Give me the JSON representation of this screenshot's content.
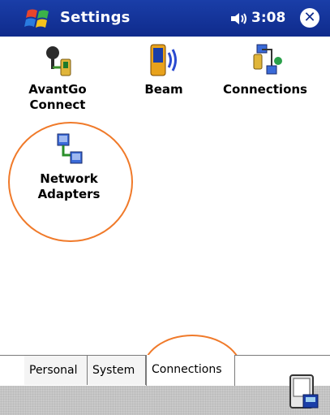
{
  "titlebar": {
    "title": "Settings",
    "time": "3:08",
    "close_label": "✕"
  },
  "icons": [
    {
      "label": "AvantGo\nConnect",
      "icon": "avantgo-icon"
    },
    {
      "label": "Beam",
      "icon": "beam-icon"
    },
    {
      "label": "Connections",
      "icon": "connections-icon"
    },
    {
      "label": "Network\nAdapters",
      "icon": "network-adapters-icon"
    }
  ],
  "tabs": [
    {
      "label": "Personal"
    },
    {
      "label": "System"
    },
    {
      "label": "Connections",
      "active": true
    }
  ],
  "colors": {
    "titlebar": "#0f2b8c",
    "annotation": "#f07a2a"
  }
}
